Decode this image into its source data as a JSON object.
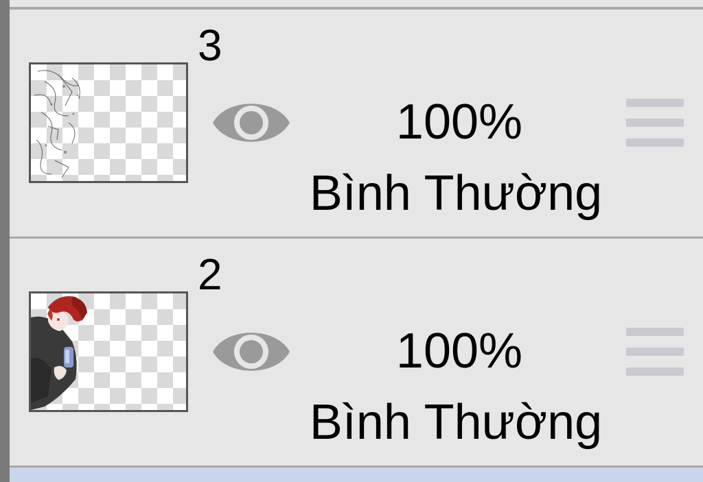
{
  "layers": [
    {
      "number": "3",
      "opacity": "100%",
      "blend_mode": "Bình Thường",
      "visible": true,
      "thumbnail": "sketch-lineart"
    },
    {
      "number": "2",
      "opacity": "100%",
      "blend_mode": "Bình Thường",
      "visible": true,
      "thumbnail": "red-haired-character"
    }
  ],
  "icons": {
    "visibility": "eye-icon",
    "reorder": "drag-handle-icon"
  },
  "colors": {
    "panel_background": "#e6e6e6",
    "selected_row": "#c9d6ea",
    "eye_icon": "#9a9a9a",
    "drag_handle": "#c9c9d1"
  }
}
